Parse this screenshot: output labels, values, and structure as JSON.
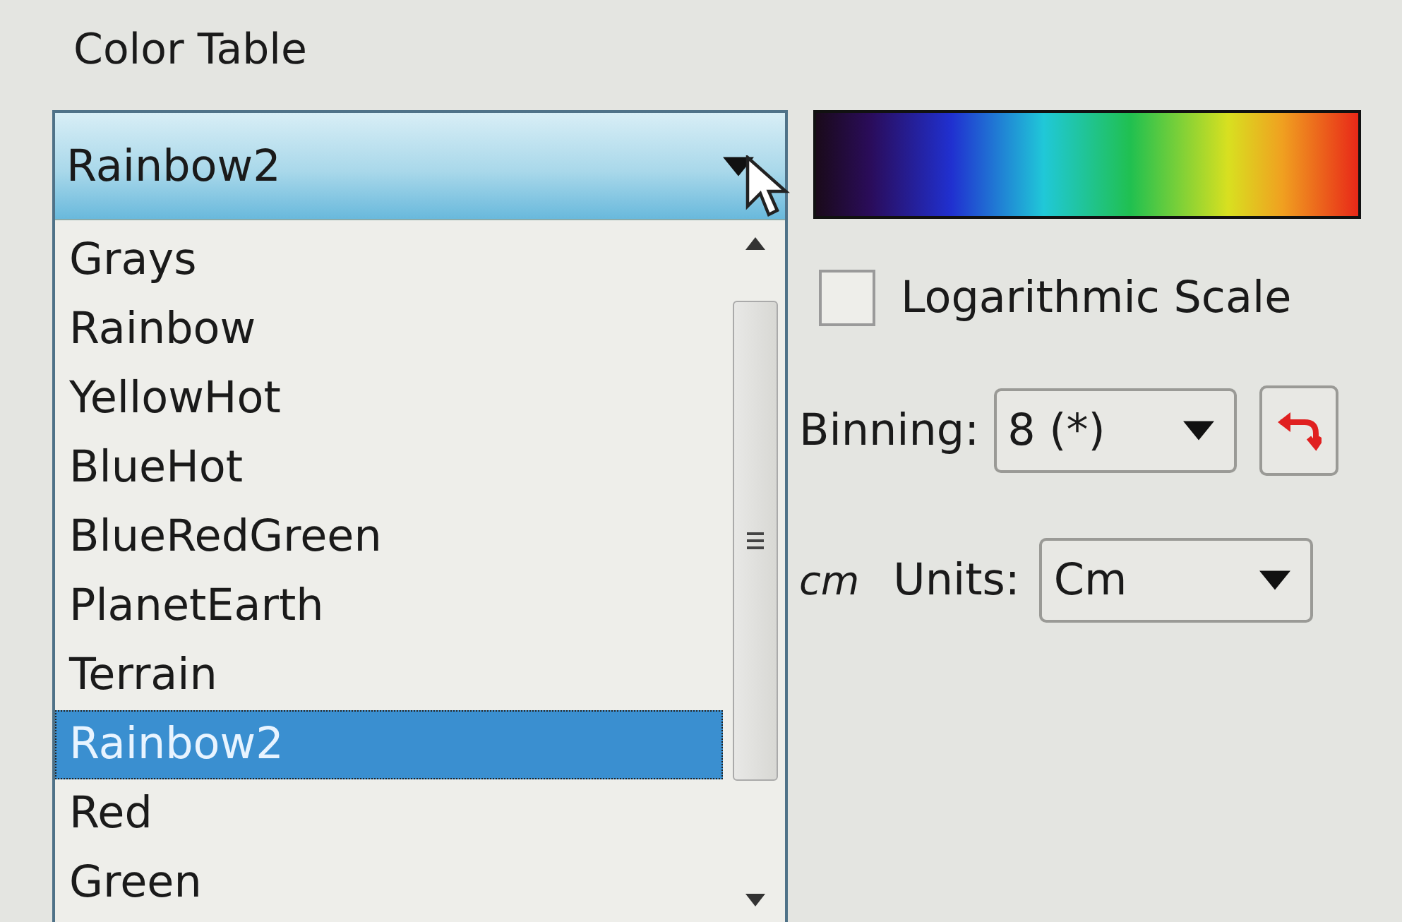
{
  "title": "Color Table",
  "color_table": {
    "value": "Rainbow2",
    "expanded": true,
    "options": [
      {
        "label": "Grays",
        "selected": false
      },
      {
        "label": "Rainbow",
        "selected": false
      },
      {
        "label": "YellowHot",
        "selected": false
      },
      {
        "label": "BlueHot",
        "selected": false
      },
      {
        "label": "BlueRedGreen",
        "selected": false
      },
      {
        "label": "PlanetEarth",
        "selected": false
      },
      {
        "label": "Terrain",
        "selected": false
      },
      {
        "label": "Rainbow2",
        "selected": true
      },
      {
        "label": "Red",
        "selected": false
      },
      {
        "label": "Green",
        "selected": false
      }
    ]
  },
  "logarithmic_scale": {
    "label": "Logarithmic Scale",
    "checked": false
  },
  "binning": {
    "label": "Binning:",
    "value": "8 (*)"
  },
  "units": {
    "prefix": "cm",
    "label": "Units:",
    "value": "Cm"
  }
}
